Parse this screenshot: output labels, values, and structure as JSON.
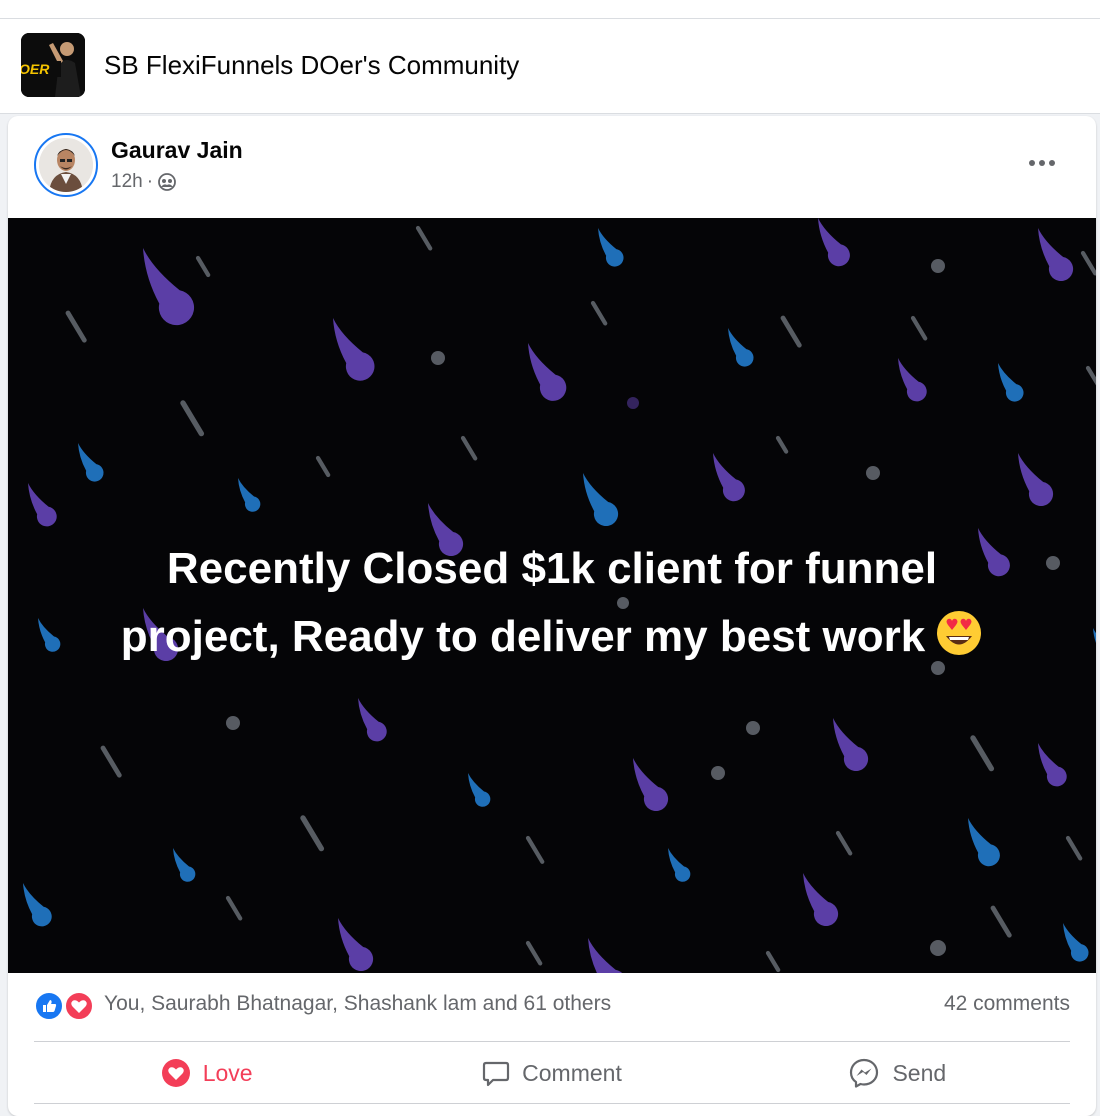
{
  "group": {
    "name": "SB FlexiFunnels DOer's Community",
    "avatar_text": "OER"
  },
  "post": {
    "author": "Gaurav Jain",
    "time": "12h",
    "separator": "·",
    "audience_icon": "group-audience-icon",
    "more_icon": "more-options-icon",
    "text_line1": "Recently Closed $1k client for funnel",
    "text_line2": "project, Ready to deliver my best work",
    "emoji": "smiling-face-with-heart-eyes-icon",
    "background_color": "#050507",
    "drop_colors": [
      "#5b3ea6",
      "#1f6fb8",
      "#9aa3ad"
    ]
  },
  "engagement": {
    "reactors": "You, Saurabh Bhatnagar, Shashank lam and 61 others",
    "comments": "42 comments",
    "reaction_icons": [
      "like-reaction-icon",
      "love-reaction-icon"
    ]
  },
  "actions": {
    "love": "Love",
    "comment": "Comment",
    "send": "Send"
  },
  "colors": {
    "love": "#f33e58",
    "like": "#1877f2",
    "secondary_text": "#65676b"
  }
}
